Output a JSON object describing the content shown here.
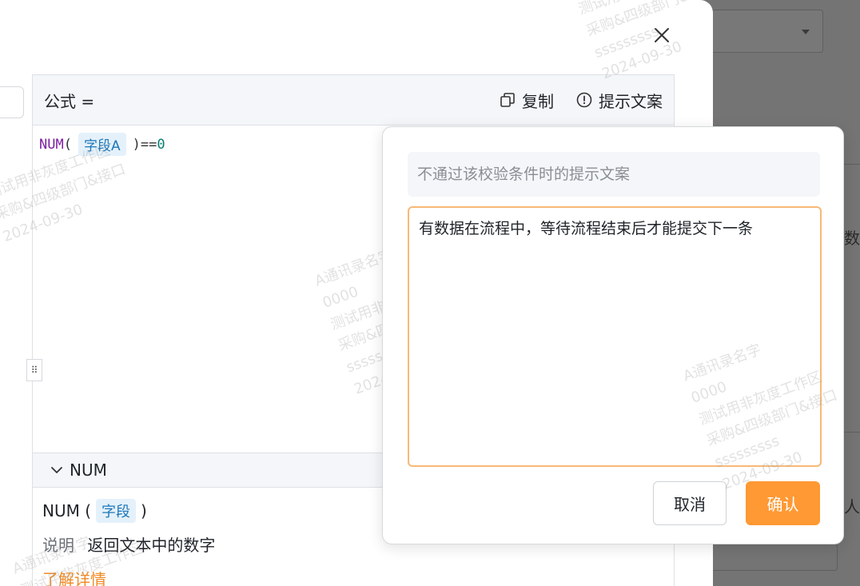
{
  "editor": {
    "title": "公式 =",
    "copy_label": "复制",
    "hint_label": "提示文案",
    "code": {
      "fn": "NUM",
      "open": "(",
      "field": "字段A",
      "close": ")",
      "op": "==",
      "value": "0"
    }
  },
  "doc": {
    "header": "NUM",
    "signature": {
      "fn": "NUM (",
      "param": "字段",
      "close": ")"
    },
    "desc_label": "说明",
    "desc_text": "返回文本中的数字",
    "link": "了解详情"
  },
  "popover": {
    "input_placeholder": "不通过该校验条件时的提示文案",
    "textarea_value": "有数据在流程中，等待流程结束后才能提交下一条",
    "cancel_label": "取消",
    "confirm_label": "确认"
  },
  "backdrop": {
    "text1": "数",
    "text2": "人起"
  },
  "watermark": [
    "A通讯录名字",
    "0000",
    "测试用非灰度工作区",
    "采购&四级部门&接口",
    "sssssssss",
    "2024-09-30"
  ],
  "colors": {
    "accent": "#ff9933",
    "link": "#f08a24",
    "tag_bg": "#e4f1fb",
    "textarea_border": "#f7b977"
  }
}
